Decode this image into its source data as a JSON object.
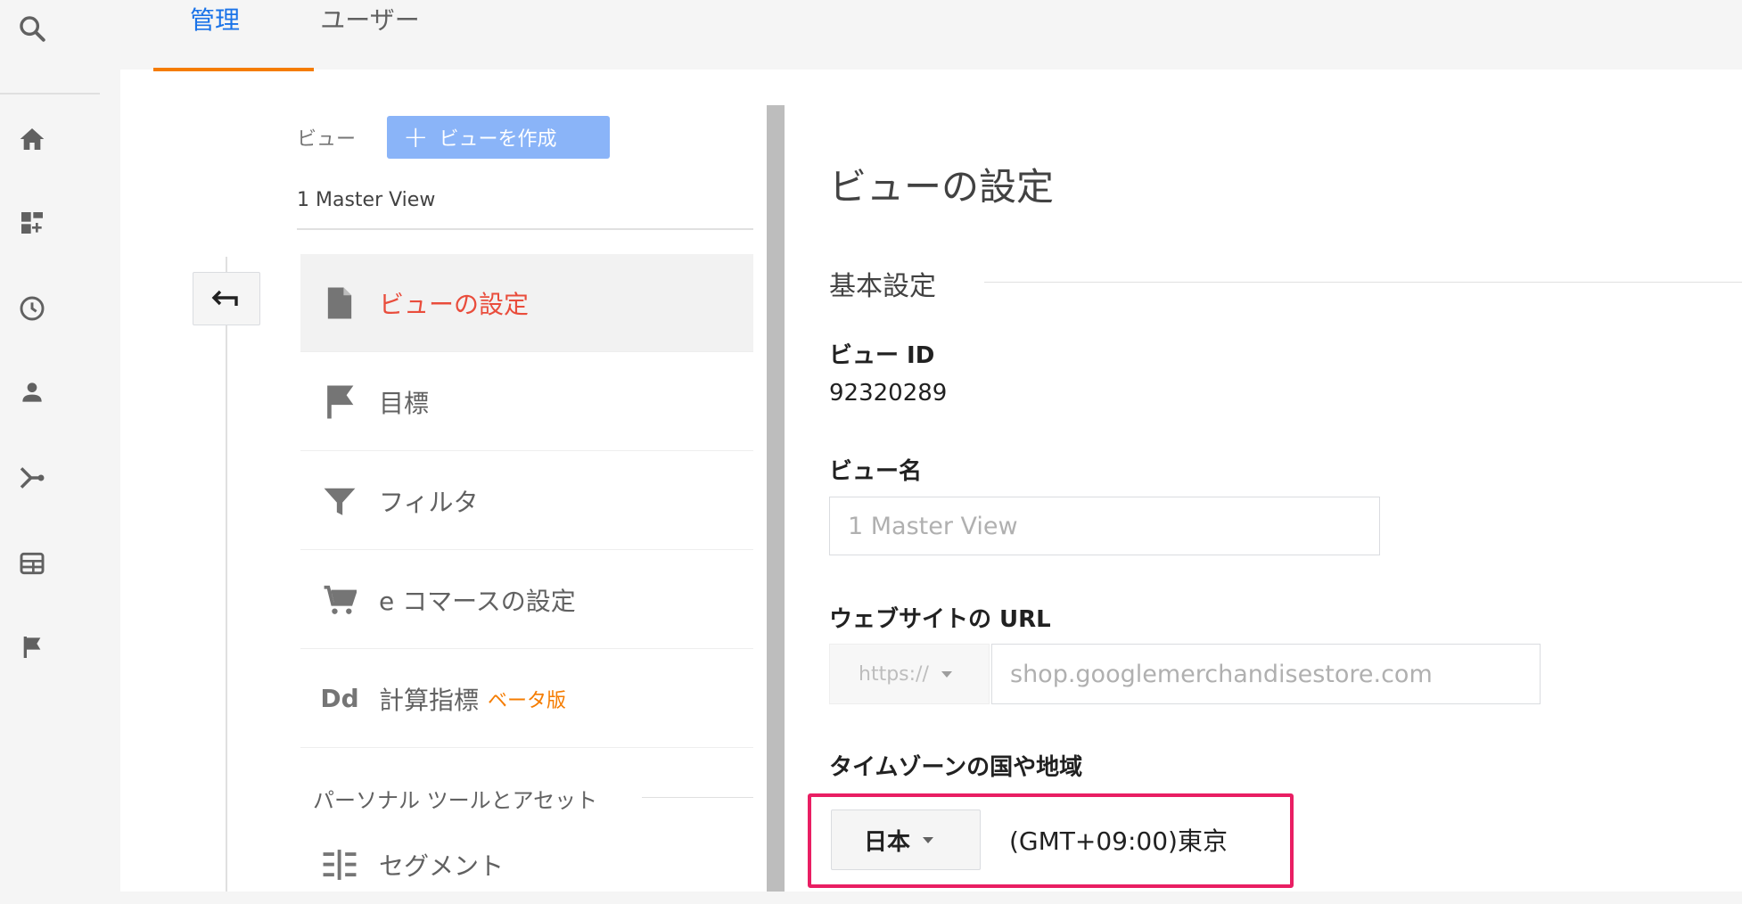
{
  "nav_tabs": [
    {
      "label": "管理",
      "active": true
    },
    {
      "label": "ユーザー",
      "active": false
    }
  ],
  "rail_icons": [
    "search-icon",
    "home-icon",
    "dashboard-icon",
    "clock-icon",
    "person-icon",
    "acquisition-icon",
    "content-icon",
    "flag-icon"
  ],
  "view_column": {
    "label": "ビュー",
    "create_button": "ビューを作成",
    "selected_view": "1 Master View",
    "menu": [
      {
        "label": "ビューの設定",
        "icon": "document-icon",
        "active": true
      },
      {
        "label": "目標",
        "icon": "flag-icon"
      },
      {
        "label": "フィルタ",
        "icon": "filter-icon"
      },
      {
        "label": "e コマースの設定",
        "icon": "cart-icon"
      },
      {
        "label": "計算指標",
        "icon": "dd-icon",
        "badge": "ベータ版",
        "icon_text": "Dd"
      }
    ],
    "personal_section": "パーソナル ツールとアセット",
    "segment_label": "セグメント"
  },
  "settings": {
    "page_title": "ビューの設定",
    "section_title": "基本設定",
    "view_id_label": "ビュー ID",
    "view_id": "92320289",
    "view_name_label": "ビュー名",
    "view_name_value": "1 Master View",
    "website_url_label": "ウェブサイトの URL",
    "url_protocol": "https://",
    "url_value": "shop.googlemerchandisestore.com",
    "timezone_label": "タイムゾーンの国や地域",
    "timezone_country": "日本",
    "timezone_value": "(GMT+09:00)東京"
  },
  "colors": {
    "accent_blue": "#1a73e8",
    "tab_underline": "#f57c00",
    "active_menu_red": "#e94d3c",
    "highlight_pink": "#e91e63",
    "beta_orange": "#f57c00"
  }
}
